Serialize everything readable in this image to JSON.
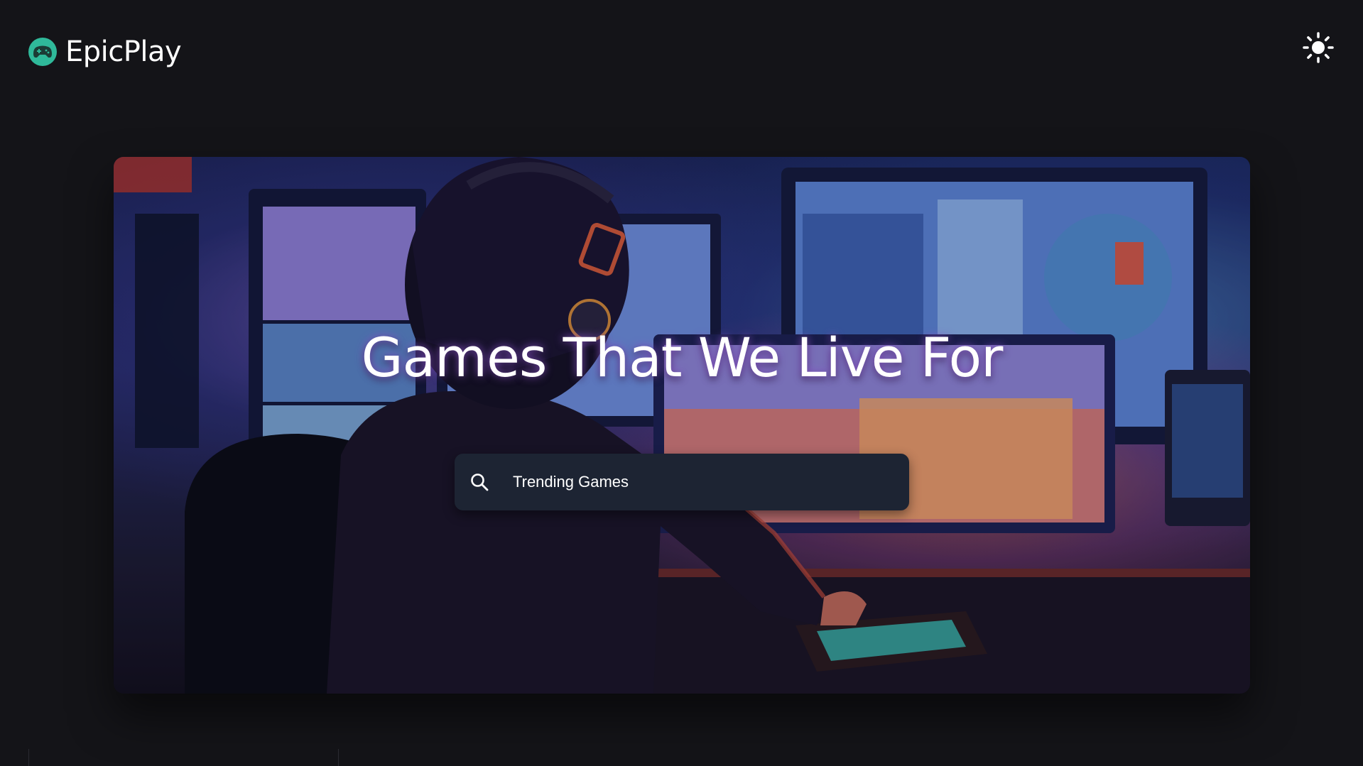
{
  "header": {
    "brand_name": "EpicPlay",
    "logo_icon": "gamepad-icon",
    "theme_toggle_icon": "sun-icon"
  },
  "hero": {
    "title": "Games That We Live For",
    "background_description_icon": "gamer-at-desk-illustration"
  },
  "search": {
    "placeholder": "Trending Games",
    "icon": "search-icon"
  },
  "colors": {
    "page_background": "#141418",
    "logo_accent": "#2fb99a",
    "search_background": "#1d2433",
    "title_glow": "#965adc"
  }
}
